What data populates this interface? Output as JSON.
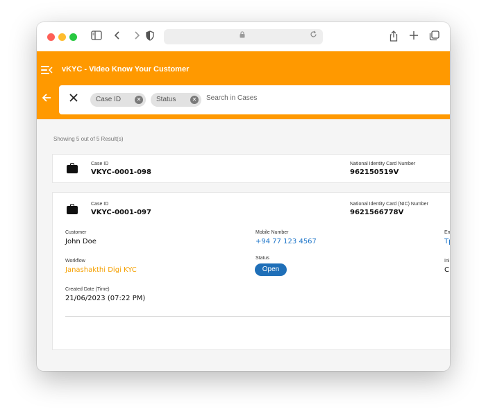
{
  "browser": {
    "icons": {
      "sidebar": "sidebar-icon",
      "back": "chevron-left-icon",
      "forward": "chevron-right-icon",
      "shield": "shield-icon",
      "lock": "lock-icon",
      "reload": "reload-icon",
      "share": "share-icon",
      "new_tab": "plus-icon",
      "tabs": "tabs-icon"
    }
  },
  "app": {
    "title": "vKYC - Video Know Your Customer",
    "accent_color": "#ff9900"
  },
  "search": {
    "chips": [
      {
        "label": "Case ID"
      },
      {
        "label": "Status"
      }
    ],
    "placeholder": "Search in Cases"
  },
  "results_text": "Showing 5 out of  5 Result(s)",
  "cases": [
    {
      "case_id_label": "Case ID",
      "case_id": "VKYC-0001-098",
      "nic_label": "National Identity Card Number",
      "nic": "962150519V"
    },
    {
      "case_id_label": "Case ID",
      "case_id": "VKYC-0001-097",
      "nic_label": "National Identity Card (NIC) Number",
      "nic": "9621566778V",
      "customer_label": "Customer",
      "customer": "John Doe",
      "mobile_label": "Mobile Number",
      "mobile": "+94 77 123 4567",
      "email_label_partial": "En",
      "email_partial": "Tp",
      "workflow_label": "Workflow",
      "workflow": "Janashakthi Digi KYC",
      "status_label": "Status",
      "status": "Open",
      "initiated_label_partial": "Ini",
      "initiated_partial": "C",
      "created_label": "Created Date (Time)",
      "created": "21/06/2023 (07:22 PM)"
    }
  ]
}
